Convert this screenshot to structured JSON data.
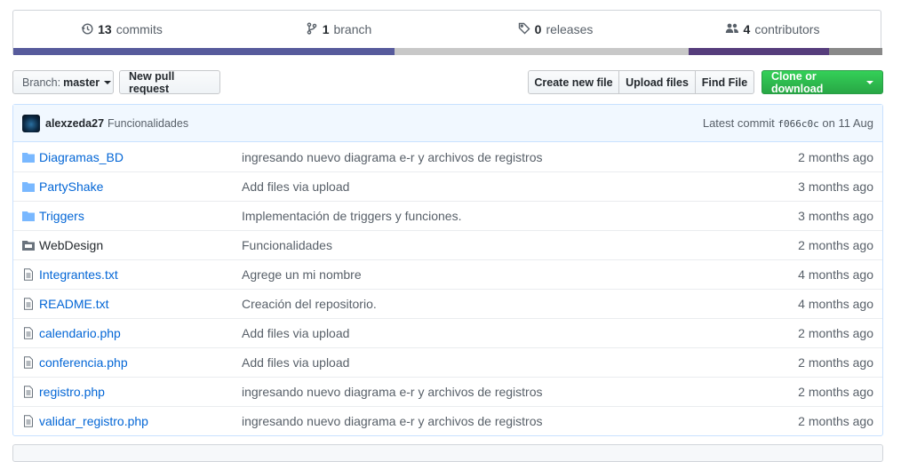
{
  "summary": {
    "commits": {
      "count": "13",
      "label": "commits",
      "icon": "history-icon"
    },
    "branches": {
      "count": "1",
      "label": "branch",
      "icon": "branch-icon"
    },
    "releases": {
      "count": "0",
      "label": "releases",
      "icon": "tag-icon"
    },
    "contributors": {
      "count": "4",
      "label": "contributors",
      "icon": "people-icon"
    },
    "language_colors": [
      "#575b9c",
      "#c8c8c8",
      "#563d7c",
      "#898989"
    ]
  },
  "toolbar": {
    "branch_label": "Branch:",
    "branch_value": "master",
    "new_pr": "New pull request",
    "create_file": "Create new file",
    "upload_files": "Upload files",
    "find_file": "Find File",
    "clone": "Clone or download"
  },
  "latest_commit": {
    "author": "alexzeda27",
    "message": "Funcionalidades",
    "prefix": "Latest commit",
    "sha": "f066c0c",
    "on": "on",
    "date": "11 Aug"
  },
  "files": [
    {
      "name": "Diagramas_BD",
      "type": "dir",
      "message": "ingresando nuevo diagrama e-r y archivos de registros",
      "age": "2 months ago"
    },
    {
      "name": "PartyShake",
      "type": "dir",
      "message": "Add files via upload",
      "age": "3 months ago"
    },
    {
      "name": "Triggers",
      "type": "dir",
      "message": "Implementación de triggers y funciones.",
      "age": "3 months ago"
    },
    {
      "name": "WebDesign",
      "type": "submodule",
      "message": "Funcionalidades",
      "age": "2 months ago"
    },
    {
      "name": "Integrantes.txt",
      "type": "file",
      "message": "Agrege un mi nombre",
      "age": "4 months ago"
    },
    {
      "name": "README.txt",
      "type": "file",
      "message": "Creación del repositorio.",
      "age": "4 months ago"
    },
    {
      "name": "calendario.php",
      "type": "file",
      "message": "Add files via upload",
      "age": "2 months ago"
    },
    {
      "name": "conferencia.php",
      "type": "file",
      "message": "Add files via upload",
      "age": "2 months ago"
    },
    {
      "name": "registro.php",
      "type": "file",
      "message": "ingresando nuevo diagrama e-r y archivos de registros",
      "age": "2 months ago"
    },
    {
      "name": "validar_registro.php",
      "type": "file",
      "message": "ingresando nuevo diagrama e-r y archivos de registros",
      "age": "2 months ago"
    }
  ]
}
